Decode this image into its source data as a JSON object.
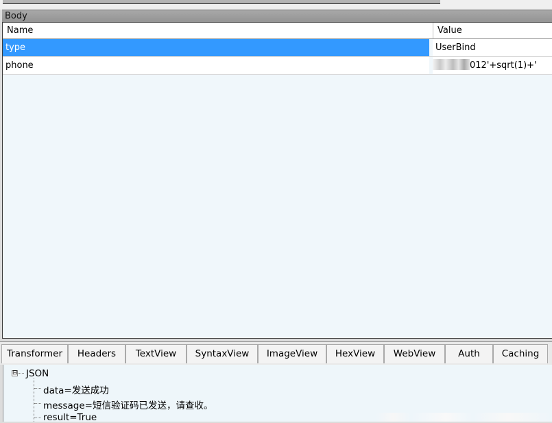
{
  "section": {
    "title": "Body"
  },
  "grid": {
    "columns": [
      "Name",
      "Value"
    ],
    "rows": [
      {
        "name": "type",
        "value": "UserBind",
        "selected": true
      },
      {
        "name": "phone",
        "value": "012'+sqrt(1)+'",
        "value_redacted_prefix": true,
        "selected": false
      }
    ]
  },
  "tabs": [
    "Transformer",
    "Headers",
    "TextView",
    "SyntaxView",
    "ImageView",
    "HexView",
    "WebView",
    "Auth",
    "Caching"
  ],
  "tree": {
    "expander": "⊟",
    "root": "JSON",
    "children": [
      "data=发送成功",
      "message=短信验证码已发送，请查收。",
      "result=True"
    ]
  },
  "colors": {
    "selection": "#3399ff",
    "header_bar": "#9c9c9c",
    "grid_background": "#f0f7fb"
  }
}
